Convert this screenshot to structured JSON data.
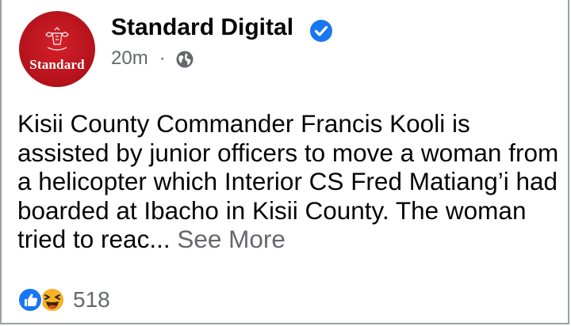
{
  "post": {
    "page_name": "Standard Digital",
    "avatar_text": "Standard",
    "timestamp": "20m",
    "separator": "·",
    "visibility_icon": "globe-icon",
    "verified_icon": "verified-badge-icon",
    "body_text": "Kisii County Commander Francis Kooli is assisted by junior officers to move a woman from a helicopter which Interior CS Fred Matiang’i had boarded at Ibacho in Kisii County. The woman tried to reac...",
    "see_more": "See More",
    "reaction_count": "518",
    "reaction_icons": [
      "like-icon",
      "haha-icon"
    ]
  },
  "colors": {
    "brand_red": "#c4161f",
    "verified_blue": "#1877f2",
    "secondary_text": "#65676b"
  }
}
